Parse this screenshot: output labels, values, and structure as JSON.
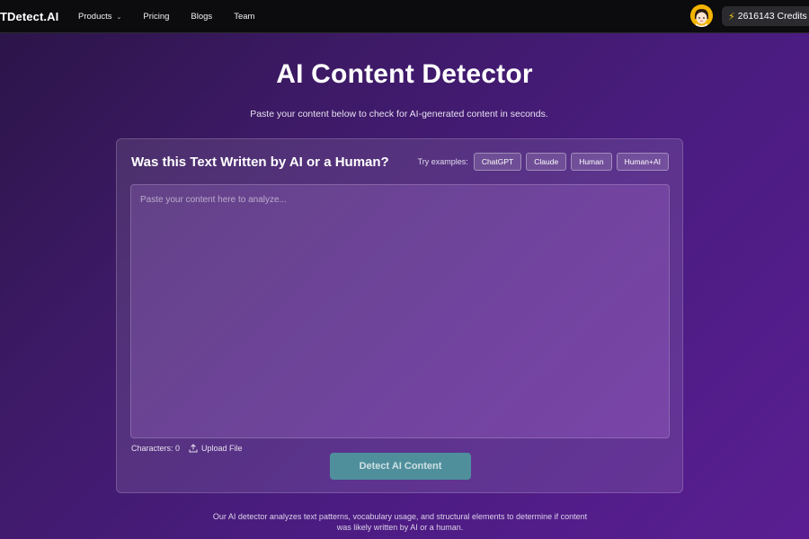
{
  "header": {
    "logo": "TDetect.AI",
    "nav": [
      {
        "label": "Products",
        "has_dropdown": true
      },
      {
        "label": "Pricing"
      },
      {
        "label": "Blogs"
      },
      {
        "label": "Team"
      }
    ],
    "credits": "2616143 Credits"
  },
  "hero": {
    "title": "AI Content Detector",
    "subtitle": "Paste your content below to check for AI-generated content in seconds."
  },
  "card": {
    "title": "Was this Text Written by AI or a Human?",
    "examples_label": "Try examples:",
    "examples": [
      "ChatGPT",
      "Claude",
      "Human",
      "Human+AI"
    ],
    "textarea_placeholder": "Paste your content here to analyze...",
    "textarea_value": "",
    "characters_label": "Characters: 0",
    "upload_label": "Upload File",
    "detect_button": "Detect AI Content"
  },
  "note": "Our AI detector analyzes text patterns, vocabulary usage, and structural elements to determine if content was likely written by AI or a human.",
  "colors": {
    "accent_button": "#4f8f9c",
    "topbar": "#0c0c0e",
    "bolt": "#f5c518"
  },
  "icons": [
    "chevron-down-icon",
    "bolt-icon",
    "upload-icon",
    "avatar"
  ]
}
